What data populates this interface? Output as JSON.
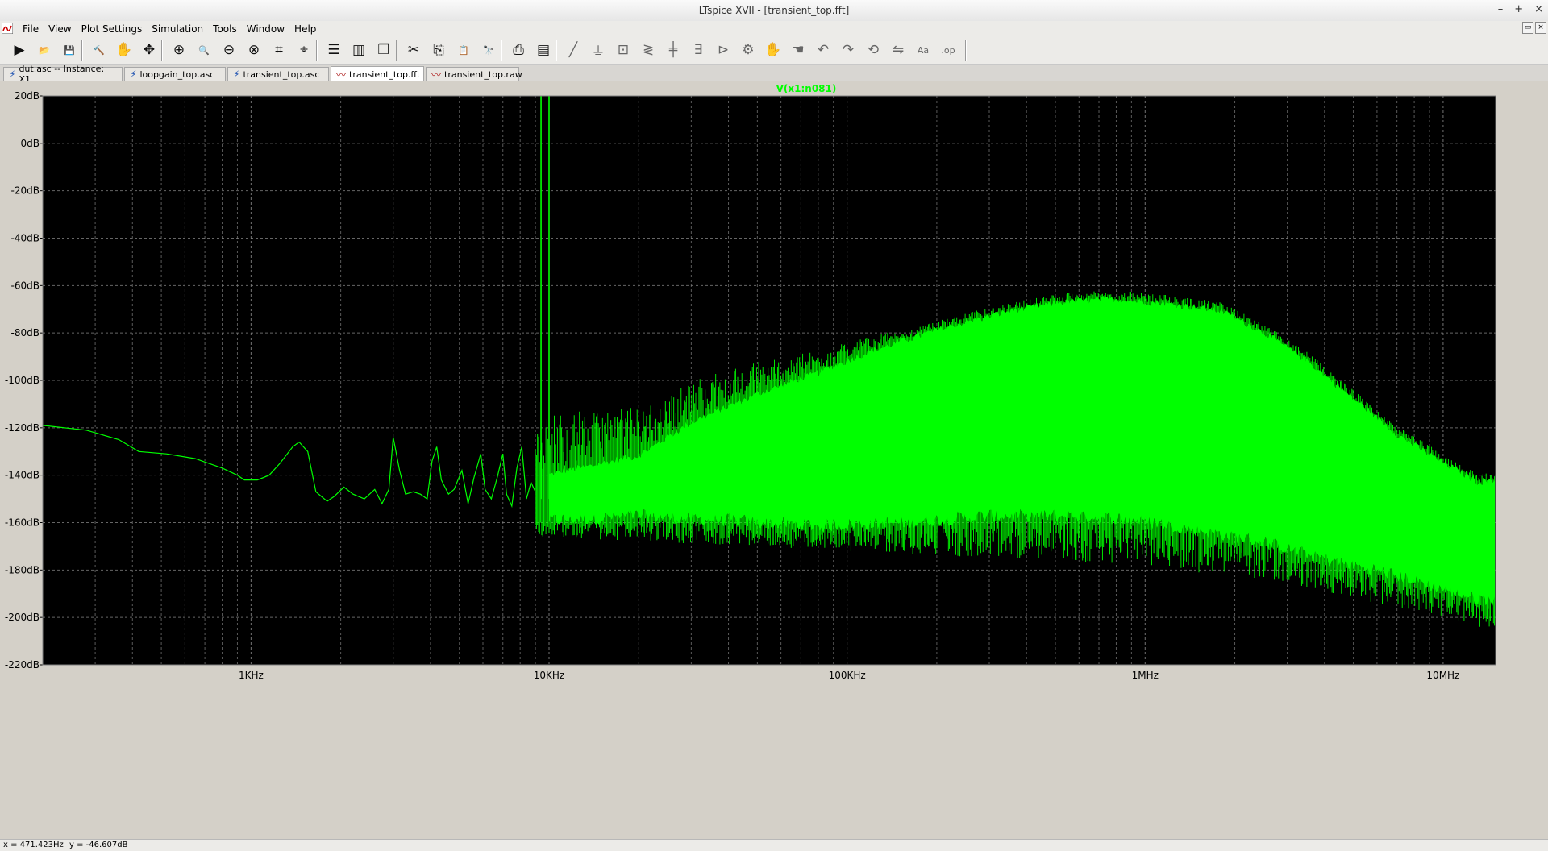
{
  "window": {
    "title": "LTspice XVII - [transient_top.fft]",
    "controls": [
      "–",
      "+",
      "×"
    ]
  },
  "menu": {
    "items": [
      "File",
      "View",
      "Plot Settings",
      "Simulation",
      "Tools",
      "Window",
      "Help"
    ]
  },
  "toolbar": {
    "buttons": [
      "run-icon",
      "open-icon",
      "save-icon",
      "control-panel-icon",
      "halt-icon",
      "pan-icon",
      "zoom-in-icon",
      "zoom-area-icon",
      "zoom-out-icon",
      "zoom-full-icon",
      "autoscale-icon",
      "cursor-icon",
      "tile-horizontal-icon",
      "tile-vertical-icon",
      "cascade-icon",
      "cut-icon",
      "copy-icon",
      "paste-icon",
      "find-icon",
      "print-icon",
      "print-setup-icon",
      "wire-icon",
      "ground-icon",
      "label-icon",
      "resistor-icon",
      "capacitor-icon",
      "inductor-icon",
      "diode-icon",
      "component-icon",
      "move-icon",
      "drag-icon",
      "undo-icon",
      "redo-icon",
      "rotate-icon",
      "mirror-icon",
      "text-icon",
      "spice-directive-icon"
    ]
  },
  "tabs": [
    {
      "label": "dut.asc -- Instance: X1",
      "icon": "schematic-icon",
      "active": false
    },
    {
      "label": "loopgain_top.asc",
      "icon": "schematic-icon",
      "active": false
    },
    {
      "label": "transient_top.asc",
      "icon": "schematic-icon",
      "active": false
    },
    {
      "label": "transient_top.fft",
      "icon": "waveform-icon",
      "active": true
    },
    {
      "label": "transient_top.raw",
      "icon": "waveform-icon",
      "active": false
    }
  ],
  "status": {
    "x": "x = 471.423Hz",
    "y": "y = -46.607dB"
  },
  "colors": {
    "trace": "#00ff00",
    "plot_bg": "#000000",
    "grid": "#808080",
    "axis_text": "#000000"
  },
  "chart_data": {
    "type": "line",
    "title": "V(x1:n081)",
    "xscale": "log",
    "xlim": [
      200,
      15000000
    ],
    "ylim": [
      -220,
      20
    ],
    "x_ticks": [
      {
        "value": 1000,
        "label": "1KHz"
      },
      {
        "value": 10000,
        "label": "10KHz"
      },
      {
        "value": 100000,
        "label": "100KHz"
      },
      {
        "value": 1000000,
        "label": "1MHz"
      },
      {
        "value": 10000000,
        "label": "10MHz"
      }
    ],
    "y_ticks": [
      {
        "value": 20,
        "label": "20dB"
      },
      {
        "value": 0,
        "label": "0dB"
      },
      {
        "value": -20,
        "label": "-20dB"
      },
      {
        "value": -40,
        "label": "-40dB"
      },
      {
        "value": -60,
        "label": "-60dB"
      },
      {
        "value": -80,
        "label": "-80dB"
      },
      {
        "value": -100,
        "label": "-100dB"
      },
      {
        "value": -120,
        "label": "-120dB"
      },
      {
        "value": -140,
        "label": "-140dB"
      },
      {
        "value": -160,
        "label": "-160dB"
      },
      {
        "value": -180,
        "label": "-180dB"
      },
      {
        "value": -200,
        "label": "-200dB"
      },
      {
        "value": -220,
        "label": "-220dB"
      }
    ],
    "grid": true,
    "series": [
      {
        "name": "V(x1:n081)",
        "low_freq_trace": [
          [
            200,
            -119
          ],
          [
            280,
            -121
          ],
          [
            360,
            -125
          ],
          [
            420,
            -130
          ],
          [
            520,
            -131
          ],
          [
            650,
            -133
          ],
          [
            800,
            -137
          ],
          [
            900,
            -140
          ],
          [
            950,
            -142
          ],
          [
            1050,
            -142
          ],
          [
            1150,
            -140
          ],
          [
            1250,
            -135
          ],
          [
            1380,
            -128
          ],
          [
            1450,
            -126
          ],
          [
            1550,
            -130
          ],
          [
            1650,
            -147
          ],
          [
            1800,
            -151
          ],
          [
            1900,
            -149
          ],
          [
            2050,
            -145
          ],
          [
            2200,
            -148
          ],
          [
            2400,
            -150
          ],
          [
            2600,
            -146
          ],
          [
            2750,
            -152
          ],
          [
            2900,
            -146
          ],
          [
            3000,
            -124
          ],
          [
            3150,
            -138
          ],
          [
            3300,
            -148
          ],
          [
            3500,
            -147
          ],
          [
            3700,
            -148
          ],
          [
            3900,
            -150
          ],
          [
            4050,
            -134
          ],
          [
            4200,
            -128
          ],
          [
            4350,
            -142
          ],
          [
            4600,
            -148
          ],
          [
            4800,
            -146
          ],
          [
            5100,
            -138
          ],
          [
            5350,
            -152
          ],
          [
            5600,
            -141
          ],
          [
            5900,
            -131
          ],
          [
            6100,
            -146
          ],
          [
            6400,
            -150
          ],
          [
            6700,
            -141
          ],
          [
            7000,
            -131
          ],
          [
            7200,
            -148
          ],
          [
            7500,
            -153
          ],
          [
            7800,
            -137
          ],
          [
            8100,
            -128
          ],
          [
            8400,
            -150
          ],
          [
            8700,
            -143
          ],
          [
            9000,
            -147
          ]
        ],
        "tones": [
          {
            "freq": 9400,
            "peak": 20
          },
          {
            "freq": 10000,
            "peak": 20
          }
        ],
        "broadband_upper": [
          [
            10000,
            -140
          ],
          [
            20000,
            -132
          ],
          [
            30000,
            -118
          ],
          [
            50000,
            -106
          ],
          [
            80000,
            -97
          ],
          [
            120000,
            -88
          ],
          [
            200000,
            -79
          ],
          [
            350000,
            -71
          ],
          [
            550000,
            -67
          ],
          [
            800000,
            -66
          ],
          [
            1200000,
            -68
          ],
          [
            1800000,
            -71
          ],
          [
            2500000,
            -80
          ],
          [
            3500000,
            -92
          ],
          [
            5000000,
            -108
          ],
          [
            7000000,
            -123
          ],
          [
            10000000,
            -135
          ],
          [
            13000000,
            -143
          ]
        ],
        "broadband_lower": [
          [
            10000,
            -160
          ],
          [
            20000,
            -158
          ],
          [
            40000,
            -160
          ],
          [
            80000,
            -162
          ],
          [
            150000,
            -161
          ],
          [
            300000,
            -158
          ],
          [
            600000,
            -158
          ],
          [
            1000000,
            -160
          ],
          [
            1500000,
            -164
          ],
          [
            2500000,
            -169
          ],
          [
            4000000,
            -176
          ],
          [
            6000000,
            -181
          ],
          [
            9000000,
            -187
          ],
          [
            13000000,
            -193
          ]
        ],
        "noise_floor_min": [
          [
            10000,
            -166
          ],
          [
            100000,
            -172
          ],
          [
            1000000,
            -178
          ],
          [
            3000000,
            -186
          ],
          [
            10000000,
            -200
          ],
          [
            13000000,
            -204
          ]
        ]
      }
    ]
  }
}
